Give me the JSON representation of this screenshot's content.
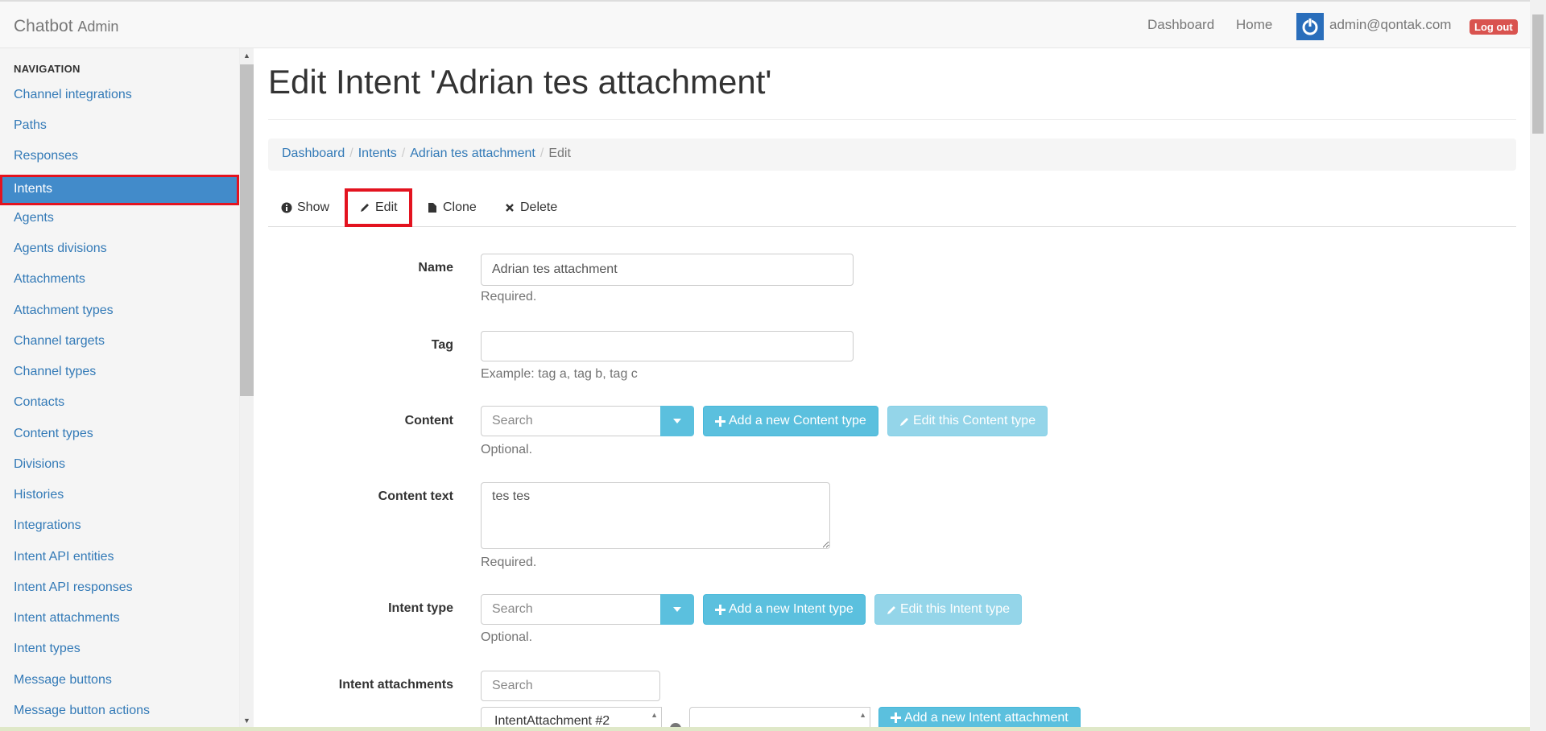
{
  "navbar": {
    "brand": "Chatbot",
    "brand_sub": "Admin",
    "links": [
      "Dashboard",
      "Home"
    ],
    "user_email": "admin@qontak.com",
    "logout_label": "Log out"
  },
  "sidebar": {
    "header": "NAVIGATION",
    "items": [
      {
        "label": "Channel integrations"
      },
      {
        "label": "Paths"
      },
      {
        "label": "Responses"
      },
      {
        "label": "Intents",
        "active": true
      },
      {
        "label": "Agents"
      },
      {
        "label": "Agents divisions"
      },
      {
        "label": "Attachments"
      },
      {
        "label": "Attachment types"
      },
      {
        "label": "Channel targets"
      },
      {
        "label": "Channel types"
      },
      {
        "label": "Contacts"
      },
      {
        "label": "Content types"
      },
      {
        "label": "Divisions"
      },
      {
        "label": "Histories"
      },
      {
        "label": "Integrations"
      },
      {
        "label": "Intent API entities"
      },
      {
        "label": "Intent API responses"
      },
      {
        "label": "Intent attachments"
      },
      {
        "label": "Intent types"
      },
      {
        "label": "Message buttons"
      },
      {
        "label": "Message button actions"
      }
    ]
  },
  "page": {
    "title": "Edit Intent 'Adrian tes attachment'",
    "breadcrumb": [
      "Dashboard",
      "Intents",
      "Adrian tes attachment",
      "Edit"
    ],
    "tabs": [
      {
        "label": "Show",
        "icon": "info-circle-icon"
      },
      {
        "label": "Edit",
        "icon": "pencil-icon",
        "active": true
      },
      {
        "label": "Clone",
        "icon": "file-icon"
      },
      {
        "label": "Delete",
        "icon": "times-icon"
      }
    ]
  },
  "form": {
    "name": {
      "label": "Name",
      "value": "Adrian tes attachment",
      "help": "Required."
    },
    "tag": {
      "label": "Tag",
      "value": "",
      "help": "Example: tag a, tag b, tag c"
    },
    "content": {
      "label": "Content",
      "placeholder": "Search",
      "help": "Optional.",
      "add_label": "Add a new Content type",
      "edit_label": "Edit this Content type"
    },
    "content_text": {
      "label": "Content text",
      "value": "tes tes",
      "help": "Required."
    },
    "intent_type": {
      "label": "Intent type",
      "placeholder": "Search",
      "help": "Optional.",
      "add_label": "Add a new Intent type",
      "edit_label": "Edit this Intent type"
    },
    "intent_attachments": {
      "label": "Intent attachments",
      "placeholder": "Search",
      "selected_option": "IntentAttachment #2",
      "add_label": "Add a new Intent attachment"
    }
  },
  "colors": {
    "accent": "#337ab7",
    "active_nav": "#428bca",
    "info_button": "#5bc0de",
    "highlight_border": "#e3131f",
    "logout": "#d9534f"
  }
}
